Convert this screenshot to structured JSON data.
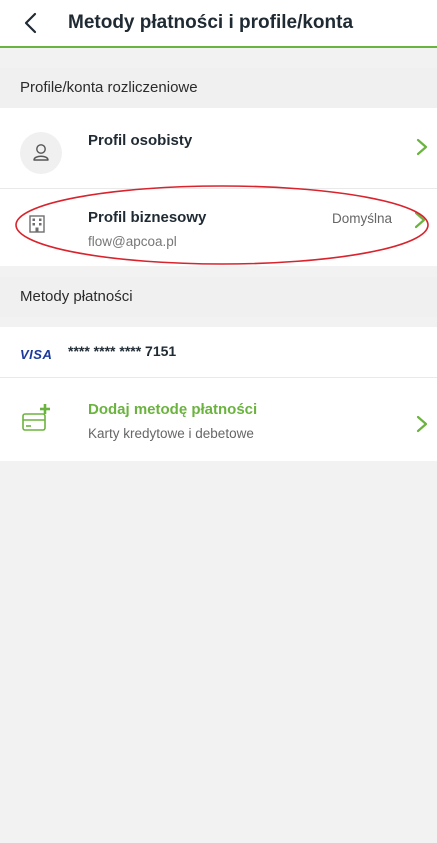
{
  "header": {
    "title": "Metody płatności i profile/konta"
  },
  "profiles_section": {
    "title": "Profile/konta rozliczeniowe"
  },
  "profiles": [
    {
      "name": "Profil osobisty"
    },
    {
      "name": "Profil biznesowy",
      "email": "flow@apcoa.pl",
      "badge": "Domyślna"
    }
  ],
  "payments_section": {
    "title": "Metody płatności"
  },
  "card": {
    "brand": "VISA",
    "number": "**** **** **** 7151"
  },
  "add_method": {
    "title": "Dodaj metodę płatności",
    "subtitle": "Karty kredytowe i debetowe"
  },
  "colors": {
    "accent": "#6bb33f",
    "annotation": "#d9232d"
  }
}
